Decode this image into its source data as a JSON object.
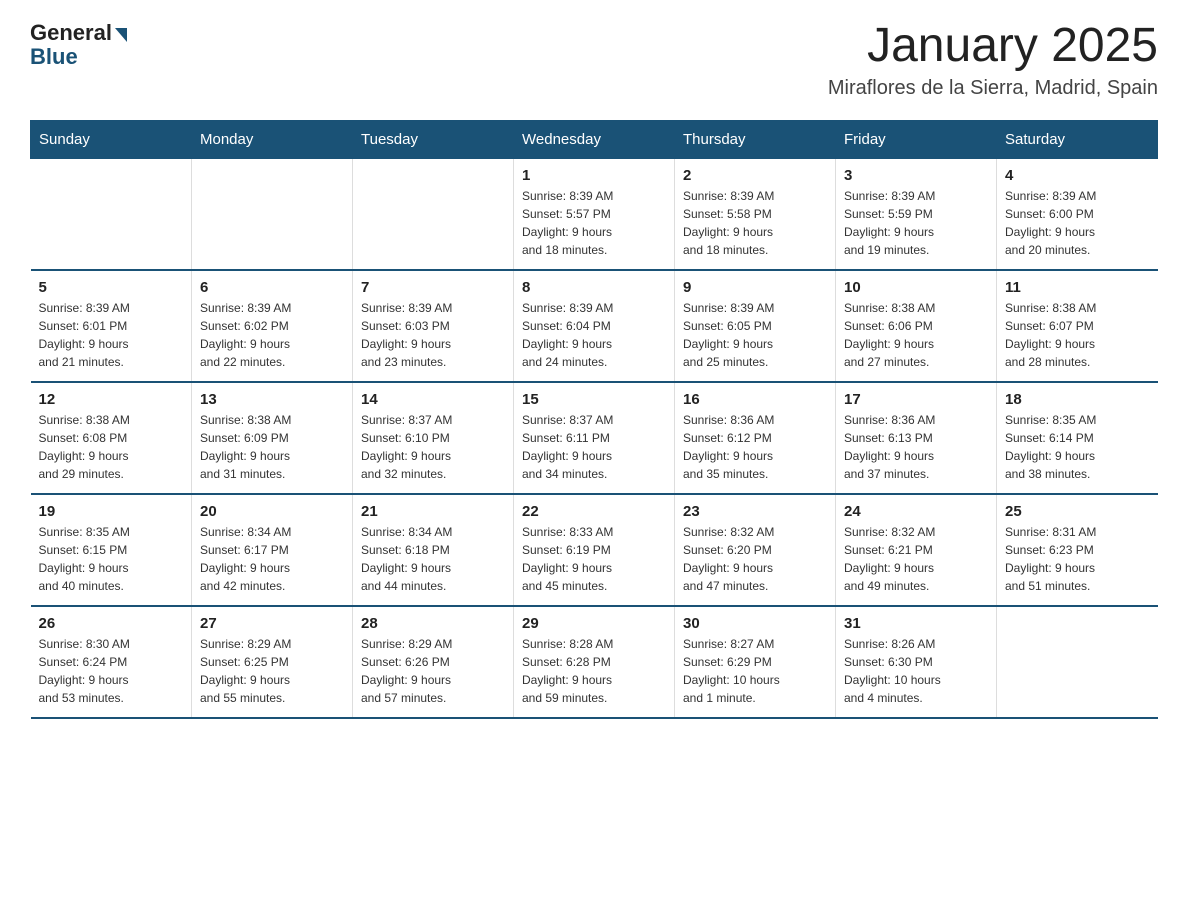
{
  "header": {
    "logo": {
      "general": "General",
      "blue": "Blue"
    },
    "title": "January 2025",
    "location": "Miraflores de la Sierra, Madrid, Spain"
  },
  "days_of_week": [
    "Sunday",
    "Monday",
    "Tuesday",
    "Wednesday",
    "Thursday",
    "Friday",
    "Saturday"
  ],
  "weeks": [
    {
      "days": [
        {
          "number": "",
          "info": ""
        },
        {
          "number": "",
          "info": ""
        },
        {
          "number": "",
          "info": ""
        },
        {
          "number": "1",
          "info": "Sunrise: 8:39 AM\nSunset: 5:57 PM\nDaylight: 9 hours\nand 18 minutes."
        },
        {
          "number": "2",
          "info": "Sunrise: 8:39 AM\nSunset: 5:58 PM\nDaylight: 9 hours\nand 18 minutes."
        },
        {
          "number": "3",
          "info": "Sunrise: 8:39 AM\nSunset: 5:59 PM\nDaylight: 9 hours\nand 19 minutes."
        },
        {
          "number": "4",
          "info": "Sunrise: 8:39 AM\nSunset: 6:00 PM\nDaylight: 9 hours\nand 20 minutes."
        }
      ]
    },
    {
      "days": [
        {
          "number": "5",
          "info": "Sunrise: 8:39 AM\nSunset: 6:01 PM\nDaylight: 9 hours\nand 21 minutes."
        },
        {
          "number": "6",
          "info": "Sunrise: 8:39 AM\nSunset: 6:02 PM\nDaylight: 9 hours\nand 22 minutes."
        },
        {
          "number": "7",
          "info": "Sunrise: 8:39 AM\nSunset: 6:03 PM\nDaylight: 9 hours\nand 23 minutes."
        },
        {
          "number": "8",
          "info": "Sunrise: 8:39 AM\nSunset: 6:04 PM\nDaylight: 9 hours\nand 24 minutes."
        },
        {
          "number": "9",
          "info": "Sunrise: 8:39 AM\nSunset: 6:05 PM\nDaylight: 9 hours\nand 25 minutes."
        },
        {
          "number": "10",
          "info": "Sunrise: 8:38 AM\nSunset: 6:06 PM\nDaylight: 9 hours\nand 27 minutes."
        },
        {
          "number": "11",
          "info": "Sunrise: 8:38 AM\nSunset: 6:07 PM\nDaylight: 9 hours\nand 28 minutes."
        }
      ]
    },
    {
      "days": [
        {
          "number": "12",
          "info": "Sunrise: 8:38 AM\nSunset: 6:08 PM\nDaylight: 9 hours\nand 29 minutes."
        },
        {
          "number": "13",
          "info": "Sunrise: 8:38 AM\nSunset: 6:09 PM\nDaylight: 9 hours\nand 31 minutes."
        },
        {
          "number": "14",
          "info": "Sunrise: 8:37 AM\nSunset: 6:10 PM\nDaylight: 9 hours\nand 32 minutes."
        },
        {
          "number": "15",
          "info": "Sunrise: 8:37 AM\nSunset: 6:11 PM\nDaylight: 9 hours\nand 34 minutes."
        },
        {
          "number": "16",
          "info": "Sunrise: 8:36 AM\nSunset: 6:12 PM\nDaylight: 9 hours\nand 35 minutes."
        },
        {
          "number": "17",
          "info": "Sunrise: 8:36 AM\nSunset: 6:13 PM\nDaylight: 9 hours\nand 37 minutes."
        },
        {
          "number": "18",
          "info": "Sunrise: 8:35 AM\nSunset: 6:14 PM\nDaylight: 9 hours\nand 38 minutes."
        }
      ]
    },
    {
      "days": [
        {
          "number": "19",
          "info": "Sunrise: 8:35 AM\nSunset: 6:15 PM\nDaylight: 9 hours\nand 40 minutes."
        },
        {
          "number": "20",
          "info": "Sunrise: 8:34 AM\nSunset: 6:17 PM\nDaylight: 9 hours\nand 42 minutes."
        },
        {
          "number": "21",
          "info": "Sunrise: 8:34 AM\nSunset: 6:18 PM\nDaylight: 9 hours\nand 44 minutes."
        },
        {
          "number": "22",
          "info": "Sunrise: 8:33 AM\nSunset: 6:19 PM\nDaylight: 9 hours\nand 45 minutes."
        },
        {
          "number": "23",
          "info": "Sunrise: 8:32 AM\nSunset: 6:20 PM\nDaylight: 9 hours\nand 47 minutes."
        },
        {
          "number": "24",
          "info": "Sunrise: 8:32 AM\nSunset: 6:21 PM\nDaylight: 9 hours\nand 49 minutes."
        },
        {
          "number": "25",
          "info": "Sunrise: 8:31 AM\nSunset: 6:23 PM\nDaylight: 9 hours\nand 51 minutes."
        }
      ]
    },
    {
      "days": [
        {
          "number": "26",
          "info": "Sunrise: 8:30 AM\nSunset: 6:24 PM\nDaylight: 9 hours\nand 53 minutes."
        },
        {
          "number": "27",
          "info": "Sunrise: 8:29 AM\nSunset: 6:25 PM\nDaylight: 9 hours\nand 55 minutes."
        },
        {
          "number": "28",
          "info": "Sunrise: 8:29 AM\nSunset: 6:26 PM\nDaylight: 9 hours\nand 57 minutes."
        },
        {
          "number": "29",
          "info": "Sunrise: 8:28 AM\nSunset: 6:28 PM\nDaylight: 9 hours\nand 59 minutes."
        },
        {
          "number": "30",
          "info": "Sunrise: 8:27 AM\nSunset: 6:29 PM\nDaylight: 10 hours\nand 1 minute."
        },
        {
          "number": "31",
          "info": "Sunrise: 8:26 AM\nSunset: 6:30 PM\nDaylight: 10 hours\nand 4 minutes."
        },
        {
          "number": "",
          "info": ""
        }
      ]
    }
  ]
}
